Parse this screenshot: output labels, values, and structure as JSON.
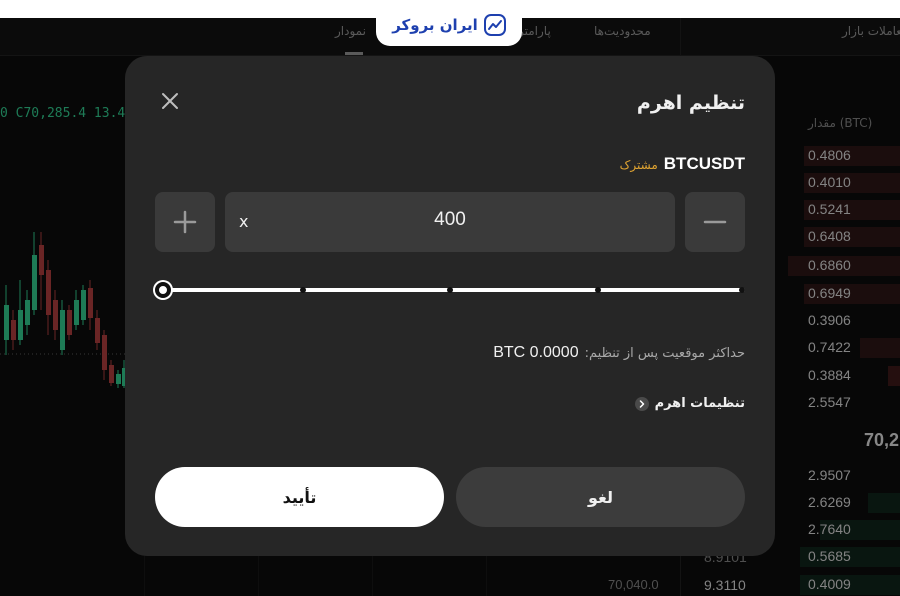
{
  "background": {
    "tabs": [
      "نمودار",
      "پارامترها",
      "محدودیت‌ها",
      "معاملات بازار"
    ],
    "ticker": "0 C70,285.4 13.4",
    "orderbook_header": "مقدار (BTC)",
    "asks": [
      "0.4806",
      "0.4010",
      "0.5241",
      "0.6408",
      "0.6860",
      "0.6949",
      "0.3906",
      "0.7422",
      "0.3884",
      "2.5547"
    ],
    "mid_price": "70,2",
    "bids": [
      "2.9507",
      "2.6269",
      "2.7640",
      "0.5685",
      "0.4009"
    ],
    "bid_left_values": [
      "8.9101",
      "9.3110"
    ],
    "bottom_price": "70,040.0"
  },
  "logo": {
    "text": "ایران بروکر"
  },
  "dialog": {
    "title": "تنظیم اهرم",
    "symbol": "BTCUSDT",
    "badge": "مشترک",
    "leverage_prefix": "x",
    "leverage_value": "400",
    "slider_fraction": 0,
    "max_position_label": "حداکثر موقعیت پس از تنظیم:",
    "max_position_value": "BTC 0.0000",
    "leverage_settings_label": "تنظیمات اهرم",
    "confirm_label": "تأیید",
    "cancel_label": "لغو"
  },
  "colors": {
    "dialog_bg": "#262626",
    "control_bg": "#3a3a3a",
    "badge": "#e0a431",
    "up": "#2ebd85",
    "down": "#a33a3a",
    "logo": "#1e40af"
  }
}
